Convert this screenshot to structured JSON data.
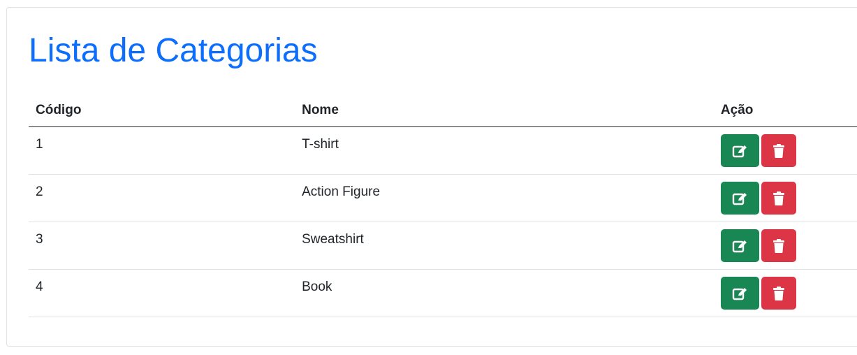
{
  "page": {
    "title": "Lista de Categorias"
  },
  "table": {
    "headers": {
      "code": "Código",
      "name": "Nome",
      "action": "Ação"
    },
    "rows": [
      {
        "code": "1",
        "name": "T-shirt"
      },
      {
        "code": "2",
        "name": "Action Figure"
      },
      {
        "code": "3",
        "name": "Sweatshirt"
      },
      {
        "code": "4",
        "name": "Book"
      }
    ]
  },
  "icons": {
    "edit": "edit-icon",
    "delete": "trash-icon"
  },
  "colors": {
    "title": "#0d6efd",
    "edit_button": "#198754",
    "delete_button": "#dc3545"
  }
}
